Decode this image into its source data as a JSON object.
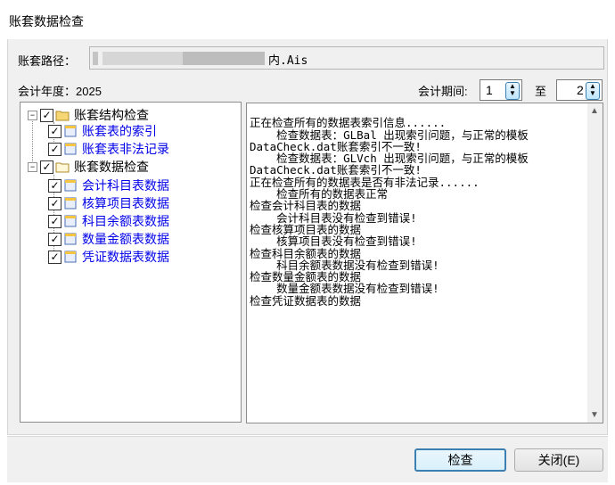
{
  "window": {
    "title": "账套数据检查"
  },
  "path": {
    "label": "账套路径：",
    "value": "内.Ais"
  },
  "year": {
    "label": "会计年度：2025"
  },
  "period": {
    "label": "会计期间:",
    "from": "1",
    "to_label": "至",
    "to": "2"
  },
  "tree": {
    "groups": [
      {
        "label": "账套结构检查",
        "children": [
          "账套表的索引",
          "账套表非法记录"
        ]
      },
      {
        "label": "账套数据检查",
        "children": [
          "会计科目表数据",
          "核算项目表数据",
          "科目余额表数据",
          "数量金额表数据",
          "凭证数据表数据"
        ]
      }
    ]
  },
  "log": {
    "lines": [
      "正在检查所有的数据表索引信息......",
      "    检查数据表：GLBal 出现索引问题，与正常的模板",
      "DataCheck.dat账套索引不一致!",
      "    检查数据表：GLVch 出现索引问题，与正常的模板",
      "DataCheck.dat账套索引不一致!",
      "正在检查所有的数据表是否有非法记录......",
      "    检查所有的数据表正常",
      "检查会计科目表的数据",
      "    会计科目表没有检查到错误!",
      "检查核算项目表的数据",
      "    核算项目表没有检查到错误!",
      "检查科目余额表的数据",
      "    科目余额表数据没有检查到错误!",
      "检查数量金额表的数据",
      "    数量金额表数据没有检查到错误!",
      "检查凭证数据表的数据"
    ]
  },
  "buttons": {
    "check": "检查",
    "close": "关闭(E)"
  },
  "colors": {
    "link_blue": "#0000e8",
    "default_button_border": "#3c7fb1"
  },
  "icons": [
    "folder-icon",
    "table-icon",
    "checkbox-checked-icon",
    "expander-minus-icon",
    "spin-arrows-icon"
  ]
}
